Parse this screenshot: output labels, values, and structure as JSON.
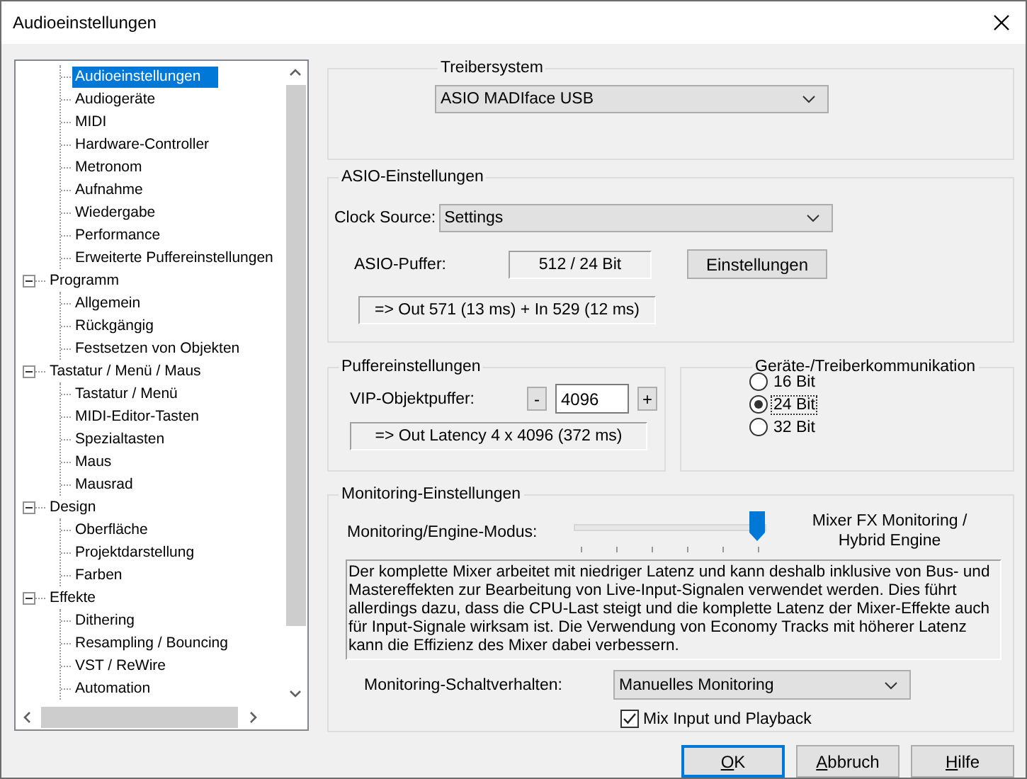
{
  "window": {
    "title": "Audioeinstellungen"
  },
  "tree": {
    "items": [
      {
        "children": [
          {
            "label": "Audioeinstellungen",
            "selected": true
          },
          {
            "label": "Audiogeräte",
            "selected": false
          },
          {
            "label": "MIDI",
            "selected": false
          },
          {
            "label": "Hardware-Controller",
            "selected": false
          },
          {
            "label": "Metronom",
            "selected": false
          },
          {
            "label": "Aufnahme",
            "selected": false
          },
          {
            "label": "Wiedergabe",
            "selected": false
          },
          {
            "label": "Performance",
            "selected": false
          },
          {
            "label": "Erweiterte Puffereinstellungen",
            "selected": false
          }
        ]
      },
      {
        "label": "Programm",
        "expanded": true,
        "selected": false,
        "children": [
          {
            "label": "Allgemein",
            "selected": false
          },
          {
            "label": "Rückgängig",
            "selected": false
          },
          {
            "label": "Festsetzen von Objekten",
            "selected": false
          }
        ]
      },
      {
        "label": "Tastatur / Menü / Maus",
        "expanded": true,
        "selected": false,
        "children": [
          {
            "label": "Tastatur / Menü",
            "selected": false
          },
          {
            "label": "MIDI-Editor-Tasten",
            "selected": false
          },
          {
            "label": "Spezialtasten",
            "selected": false
          },
          {
            "label": "Maus",
            "selected": false
          },
          {
            "label": "Mausrad",
            "selected": false
          }
        ]
      },
      {
        "label": "Design",
        "expanded": true,
        "selected": false,
        "children": [
          {
            "label": "Oberfläche",
            "selected": false
          },
          {
            "label": "Projektdarstellung",
            "selected": false
          },
          {
            "label": "Farben",
            "selected": false
          }
        ]
      },
      {
        "label": "Effekte",
        "expanded": true,
        "selected": false,
        "children": [
          {
            "label": "Dithering",
            "selected": false
          },
          {
            "label": "Resampling / Bouncing",
            "selected": false
          },
          {
            "label": "VST / ReWire",
            "selected": false
          },
          {
            "label": "Automation",
            "selected": false
          }
        ]
      }
    ]
  },
  "driver_system": {
    "title": "Treibersystem",
    "device": "ASIO MADIface USB"
  },
  "asio": {
    "title": "ASIO-Einstellungen",
    "clock_label": "Clock Source:",
    "clock_value": "Settings",
    "buffer_label": "ASIO-Puffer:",
    "buffer_value": "512 / 24 Bit",
    "settings_button": "Einstellungen",
    "latency": "=> Out 571 (13 ms) + In 529 (12 ms)"
  },
  "buffer": {
    "title": "Puffereinstellungen",
    "label": "VIP-Objektpuffer:",
    "minus": "-",
    "value": "4096",
    "plus": "+",
    "latency": "=> Out Latency 4 x 4096 (372 ms)"
  },
  "bit_depth": {
    "title": "Geräte-/Treiberkommunikation",
    "options": [
      {
        "label": "16 Bit",
        "selected": false
      },
      {
        "label": "24 Bit",
        "selected": true
      },
      {
        "label": "32 Bit",
        "selected": false
      }
    ]
  },
  "monitoring": {
    "title": "Monitoring-Einstellungen",
    "mode_label": "Monitoring/Engine-Modus:",
    "mode_slider": {
      "level": 1
    },
    "mode_value": "Mixer FX Monitoring / Hybrid Engine",
    "description": "Der komplette Mixer arbeitet mit niedriger Latenz und kann deshalb inklusive von Bus- und Mastereffekten zur Bearbeitung von Live-Input-Signalen verwendet werden. Dies führt allerdings dazu, dass die CPU-Last steigt und die komplette Latenz der Mixer-Effekte auch für Input-Signale wirksam ist. Die Verwendung von Economy Tracks mit höherer Latenz kann die Effizienz des Mixer dabei verbessern.",
    "switch_label": "Monitoring-Schaltverhalten:",
    "switch_value": "Manuelles Monitoring",
    "mix": {
      "label": "Mix Input und Playback",
      "checked": true
    }
  },
  "buttons": [
    {
      "label": "OK",
      "default": true
    },
    {
      "label": "Abbruch",
      "default": false
    },
    {
      "label": "Hilfe",
      "default": false
    }
  ]
}
